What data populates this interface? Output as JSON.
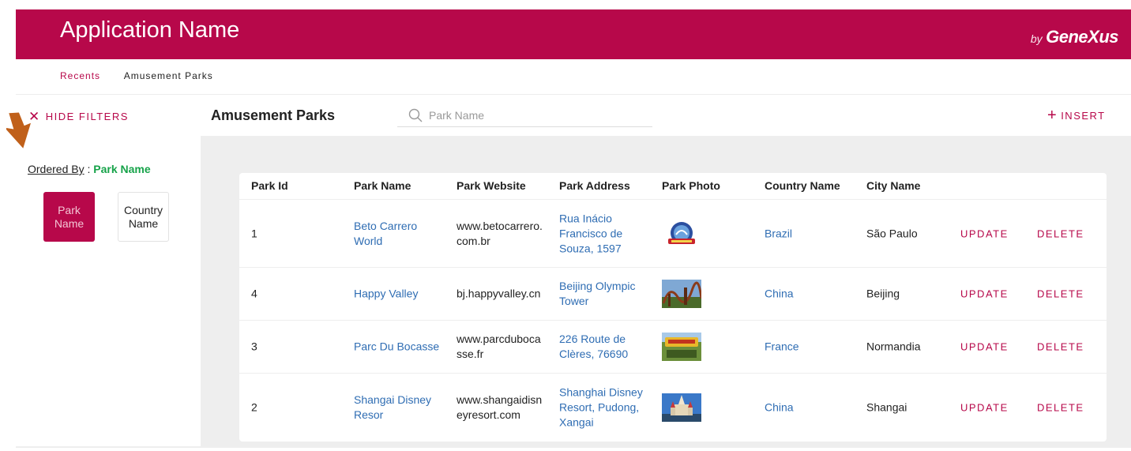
{
  "header": {
    "title": "Application Name",
    "brand_by": "by",
    "brand_name": "GeneXus",
    "color": "#b7084a"
  },
  "breadcrumb": {
    "recents": "Recents",
    "current": "Amusement Parks"
  },
  "filters": {
    "hide_label": "HIDE FILTERS",
    "ordered_by_label": "Ordered By",
    "ordered_by_sep": " : ",
    "ordered_by_value": "Park Name",
    "order_options": [
      {
        "line1": "Park",
        "line2": "Name",
        "active": true
      },
      {
        "line1": "Country",
        "line2": "Name",
        "active": false
      }
    ]
  },
  "grid": {
    "title": "Amusement Parks",
    "search_placeholder": "Park Name",
    "insert_label": "INSERT",
    "columns": [
      "Park Id",
      "Park Name",
      "Park Website",
      "Park Address",
      "Park Photo",
      "Country Name",
      "City Name"
    ],
    "update_label": "UPDATE",
    "delete_label": "DELETE",
    "rows": [
      {
        "id": "1",
        "name_lines": [
          "Beto Carrero",
          "World"
        ],
        "website_lines": [
          "www.betocarrero.",
          "com.br"
        ],
        "address_lines": [
          "Rua Inácio",
          "Francisco de",
          "Souza, 1597"
        ],
        "photo": "beto-carrero-logo",
        "country": "Brazil",
        "city": "São Paulo"
      },
      {
        "id": "4",
        "name_lines": [
          "Happy Valley"
        ],
        "website_lines": [
          "bj.happyvalley.cn"
        ],
        "address_lines": [
          "Beijing Olympic",
          "Tower"
        ],
        "photo": "happy-valley-photo",
        "country": "China",
        "city": "Beijing"
      },
      {
        "id": "3",
        "name_lines": [
          "Parc Du Bocasse"
        ],
        "website_lines": [
          "www.parcduboca",
          "sse.fr"
        ],
        "address_lines": [
          "226 Route de",
          "Clères, 76690"
        ],
        "photo": "parc-du-bocasse-photo",
        "country": "France",
        "city": "Normandia"
      },
      {
        "id": "2",
        "name_lines": [
          "Shangai Disney",
          "Resor"
        ],
        "website_lines": [
          "www.shangaidisn",
          "eyresort.com"
        ],
        "address_lines": [
          "Shanghai Disney",
          "Resort, Pudong,",
          "Xangai"
        ],
        "photo": "shanghai-disney-photo",
        "country": "China",
        "city": "Shangai"
      }
    ]
  },
  "annotation": {
    "arrow_icon": "down-arrow-icon",
    "arrow_color": "#c0601a"
  }
}
